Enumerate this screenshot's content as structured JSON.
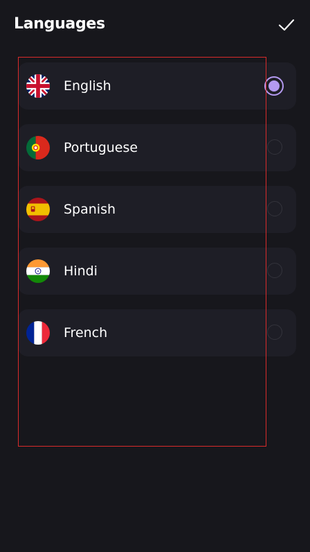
{
  "header": {
    "title": "Languages",
    "confirm_icon": "checkmark-icon"
  },
  "colors": {
    "background": "#17171c",
    "row_background": "#1e1e26",
    "accent": "#b49af0",
    "radio_border": "#34343c",
    "outline": "#d92b2b"
  },
  "languages": [
    {
      "label": "English",
      "flag": "uk-flag-icon",
      "selected": true
    },
    {
      "label": "Portuguese",
      "flag": "portugal-flag-icon",
      "selected": false
    },
    {
      "label": "Spanish",
      "flag": "spain-flag-icon",
      "selected": false
    },
    {
      "label": "Hindi",
      "flag": "india-flag-icon",
      "selected": false
    },
    {
      "label": "French",
      "flag": "france-flag-icon",
      "selected": false
    }
  ]
}
